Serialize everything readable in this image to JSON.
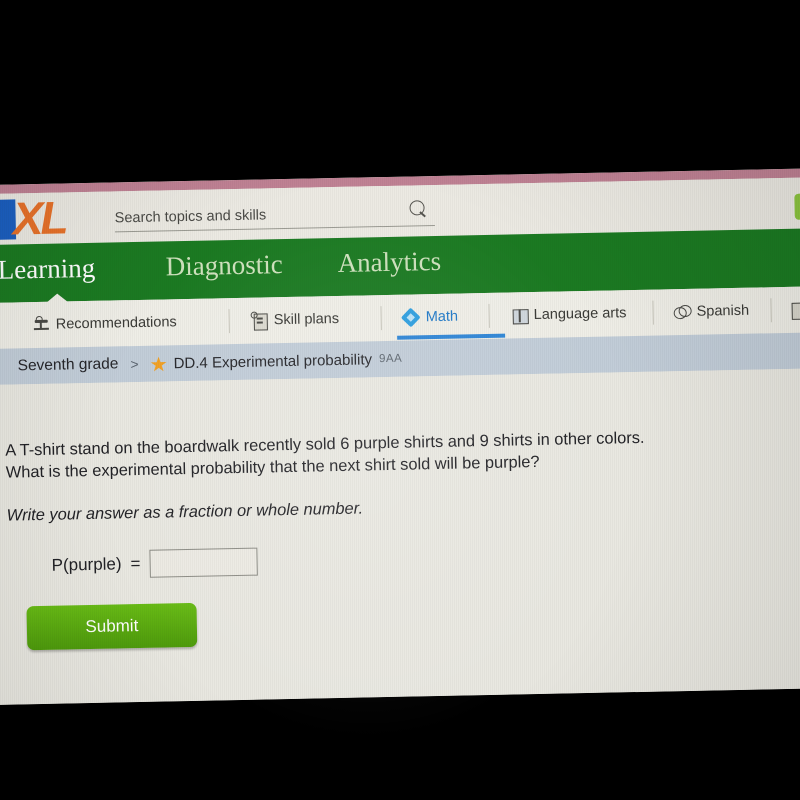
{
  "brand": {
    "logo_text": "XL",
    "logo_name": "IXL"
  },
  "search": {
    "placeholder": "Search topics and skills",
    "value": "",
    "icon": "search-icon"
  },
  "primary_nav": {
    "items": [
      {
        "label": "Learning",
        "active": true
      },
      {
        "label": "Diagnostic",
        "active": false
      },
      {
        "label": "Analytics",
        "active": false
      }
    ]
  },
  "subject_tabs": {
    "items": [
      {
        "label": "Recommendations",
        "icon": "recommendations-icon",
        "active": false
      },
      {
        "label": "Skill plans",
        "icon": "skill-plans-icon",
        "active": false
      },
      {
        "label": "Math",
        "icon": "math-icon",
        "active": true
      },
      {
        "label": "Language arts",
        "icon": "language-arts-icon",
        "active": false
      },
      {
        "label": "Spanish",
        "icon": "spanish-icon",
        "active": false
      },
      {
        "label": "",
        "icon": "science-icon",
        "active": false
      }
    ],
    "active_color": "#2079c8"
  },
  "breadcrumb": {
    "grade": "Seventh grade",
    "separator": ">",
    "star_icon": "star-icon",
    "skill": "DD.4 Experimental probability",
    "code": "9AA"
  },
  "question": {
    "line1": "A T-shirt stand on the boardwalk recently sold 6 purple shirts and 9 shirts in other colors.",
    "line2": "What is the experimental probability that the next shirt sold will be purple?",
    "instruction": "Write your answer as a fraction or whole number.",
    "answer_label": "P(purple)",
    "equals": "=",
    "answer_value": "",
    "answer_placeholder": ""
  },
  "actions": {
    "submit_label": "Submit",
    "submit_color": "#57b10e"
  },
  "colors": {
    "green_nav": "#1b7a22",
    "breadcrumb_bar": "#c2cdd8",
    "page_background": "#e9e8e1",
    "top_strip": "#c08294",
    "logo_blue": "#1b5fc1",
    "logo_orange": "#e8722a"
  }
}
